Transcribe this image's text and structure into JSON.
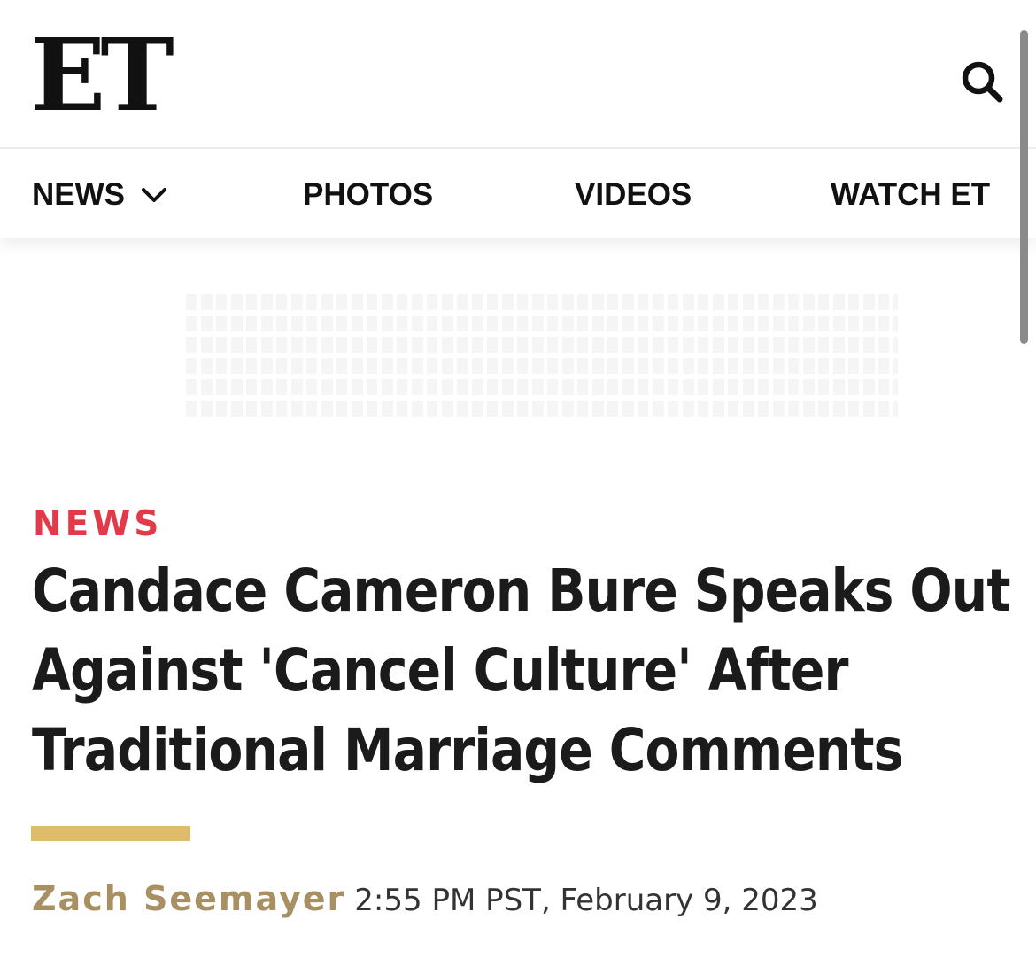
{
  "header": {
    "logo_text": "ET",
    "search_icon": "search-icon"
  },
  "nav": {
    "items": [
      {
        "label": "NEWS",
        "has_dropdown": true,
        "dropdown_icon": "chevron-down-icon"
      },
      {
        "label": "PHOTOS"
      },
      {
        "label": "VIDEOS"
      },
      {
        "label": "WATCH ET"
      }
    ]
  },
  "article": {
    "category": "NEWS",
    "headline": "Candace Cameron Bure Speaks Out Against 'Cancel Culture' After Traditional Marriage Comments",
    "author": "Zach Seemayer",
    "timestamp": "2:55 PM PST, February 9, 2023"
  },
  "colors": {
    "category": "#e23a48",
    "accent_bar": "#dfbc6b",
    "author": "#a89062",
    "text": "#1b1b1b"
  }
}
